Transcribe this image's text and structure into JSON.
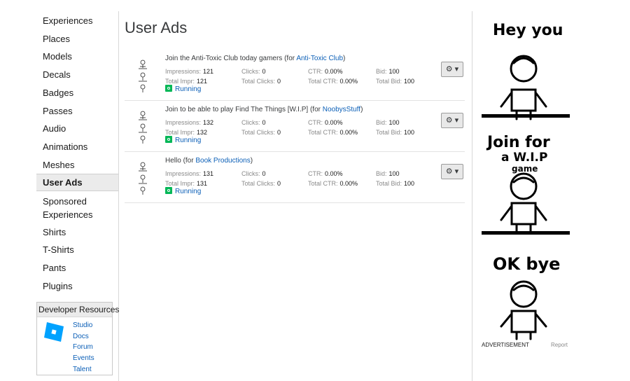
{
  "nav": {
    "items": [
      {
        "label": "Experiences"
      },
      {
        "label": "Places"
      },
      {
        "label": "Models"
      },
      {
        "label": "Decals"
      },
      {
        "label": "Badges"
      },
      {
        "label": "Passes"
      },
      {
        "label": "Audio"
      },
      {
        "label": "Animations"
      },
      {
        "label": "Meshes"
      },
      {
        "label": "User Ads"
      },
      {
        "label": "Sponsored"
      },
      {
        "label": "Experiences"
      },
      {
        "label": "Shirts"
      },
      {
        "label": "T-Shirts"
      },
      {
        "label": "Pants"
      },
      {
        "label": "Plugins"
      }
    ],
    "active": "User Ads"
  },
  "dev_resources": {
    "title": "Developer Resources",
    "links": [
      "Studio",
      "Docs",
      "Forum",
      "Events",
      "Talent"
    ]
  },
  "page": {
    "title": "User Ads"
  },
  "stat_labels": {
    "impressions": "Impressions:",
    "total_impr": "Total Impr:",
    "clicks": "Clicks:",
    "total_clicks": "Total Clicks:",
    "ctr": "CTR:",
    "total_ctr": "Total CTR:",
    "bid": "Bid:",
    "total_bid": "Total Bid:"
  },
  "ads": [
    {
      "title": "Join the Anti-Toxic Club today gamers",
      "for_prefix": " (for ",
      "for_name": "Anti-Toxic Club",
      "for_suffix": ")",
      "impressions": "121",
      "total_impr": "121",
      "clicks": "0",
      "total_clicks": "0",
      "ctr": "0.00%",
      "total_ctr": "0.00%",
      "bid": "100",
      "total_bid": "100",
      "status": "Running"
    },
    {
      "title": "Join to be able to play Find The Things [W.I.P]",
      "for_prefix": " (for ",
      "for_name": "NoobysStuff",
      "for_suffix": ")",
      "impressions": "132",
      "total_impr": "132",
      "clicks": "0",
      "total_clicks": "0",
      "ctr": "0.00%",
      "total_ctr": "0.00%",
      "bid": "100",
      "total_bid": "100",
      "status": "Running"
    },
    {
      "title": "Hello",
      "for_prefix": " (for ",
      "for_name": "Book Productions",
      "for_suffix": ")",
      "impressions": "131",
      "total_impr": "131",
      "clicks": "0",
      "total_clicks": "0",
      "ctr": "0.00%",
      "total_ctr": "0.00%",
      "bid": "100",
      "total_bid": "100",
      "status": "Running"
    }
  ],
  "gear_button": "⚙ ▾",
  "advert": {
    "text_1": "Hey you",
    "text_2": "Join for",
    "text_3": "a W.I.P",
    "text_4": "game",
    "text_5": "OK bye",
    "label": "ADVERTISEMENT",
    "report": "Report"
  },
  "colors": {
    "link": "#0b5fb7",
    "running": "#02b757",
    "active_bg": "#ebebeb"
  }
}
